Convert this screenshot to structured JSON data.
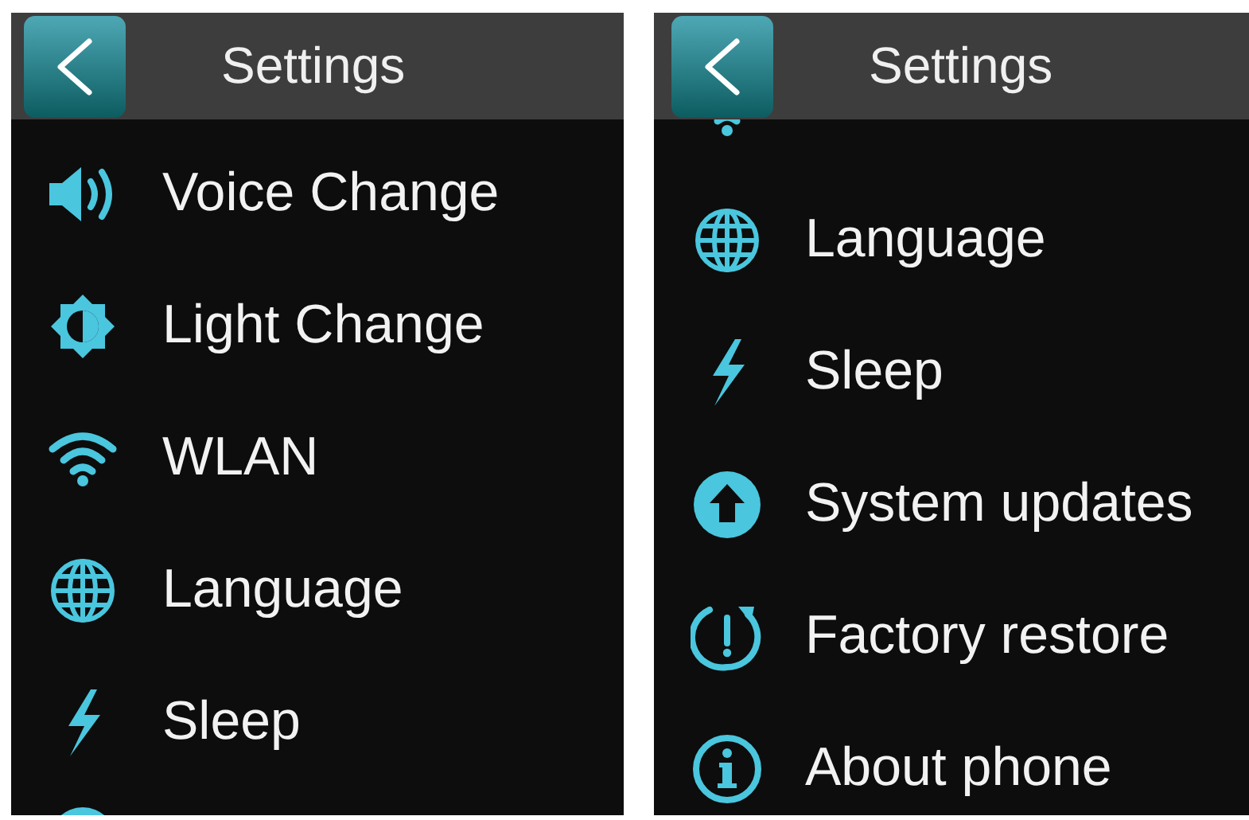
{
  "screens": [
    {
      "title": "Settings",
      "items": [
        {
          "kind": "voice",
          "label": "Voice Change",
          "clipped": false
        },
        {
          "kind": "light",
          "label": "Light Change",
          "clipped": false
        },
        {
          "kind": "wlan",
          "label": "WLAN",
          "clipped": false
        },
        {
          "kind": "language",
          "label": "Language",
          "clipped": false
        },
        {
          "kind": "sleep",
          "label": "Sleep",
          "clipped": false
        },
        {
          "kind": "update",
          "clipped": true
        }
      ]
    },
    {
      "title": "Settings",
      "items": [
        {
          "kind": "wlan",
          "clipped": true
        },
        {
          "kind": "language",
          "label": "Language",
          "clipped": false
        },
        {
          "kind": "sleep",
          "label": "Sleep",
          "clipped": false
        },
        {
          "kind": "update",
          "label": "System updates",
          "clipped": false
        },
        {
          "kind": "restore",
          "label": "Factory restore",
          "clipped": false
        },
        {
          "kind": "about",
          "label": "About phone",
          "clipped": false
        }
      ]
    }
  ]
}
